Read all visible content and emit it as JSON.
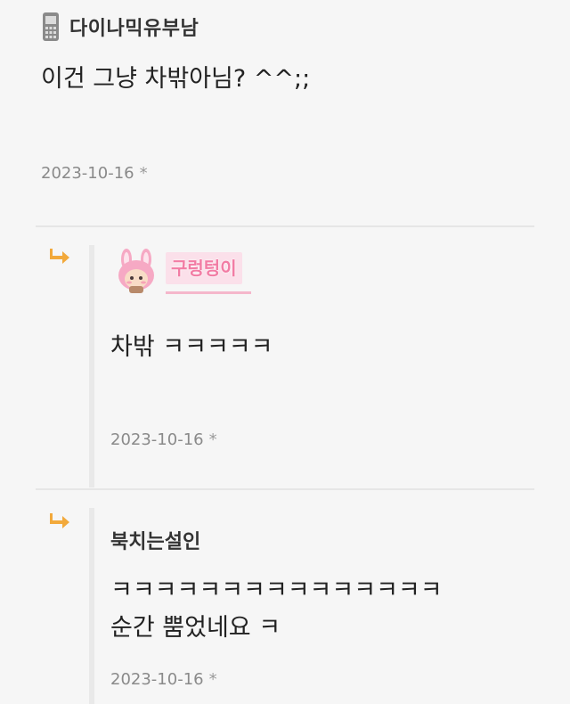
{
  "comment": {
    "author": "다이나믹유부남",
    "author_icon": "phone-icon",
    "text": "이건 그냥 차밖아님? ^^;;",
    "date": "2023-10-16",
    "date_mark": "*"
  },
  "replies": [
    {
      "nickname": "구렁텅이",
      "nickname_style": "pink-badge",
      "avatar_icon": "pink-bunny-avatar-icon",
      "reply_icon": "reply-arrow-icon",
      "text": "차밖 ㅋㅋㅋㅋㅋ",
      "date": "2023-10-16",
      "date_mark": "*"
    },
    {
      "nickname": "북치는설인",
      "reply_icon": "reply-arrow-icon",
      "text_line1": "ㅋㅋㅋㅋㅋㅋㅋㅋㅋㅋㅋㅋㅋㅋㅋ",
      "text_line2": "순간 뿜었네요 ㅋ",
      "date": "2023-10-16",
      "date_mark": "*"
    }
  ],
  "colors": {
    "background": "#f6f6f6",
    "reply_arrow": "#f2a93b",
    "nickname_badge_bg": "#fbe0ea",
    "nickname_badge_text": "#f27ca4",
    "date_text": "#8a8a8a"
  }
}
